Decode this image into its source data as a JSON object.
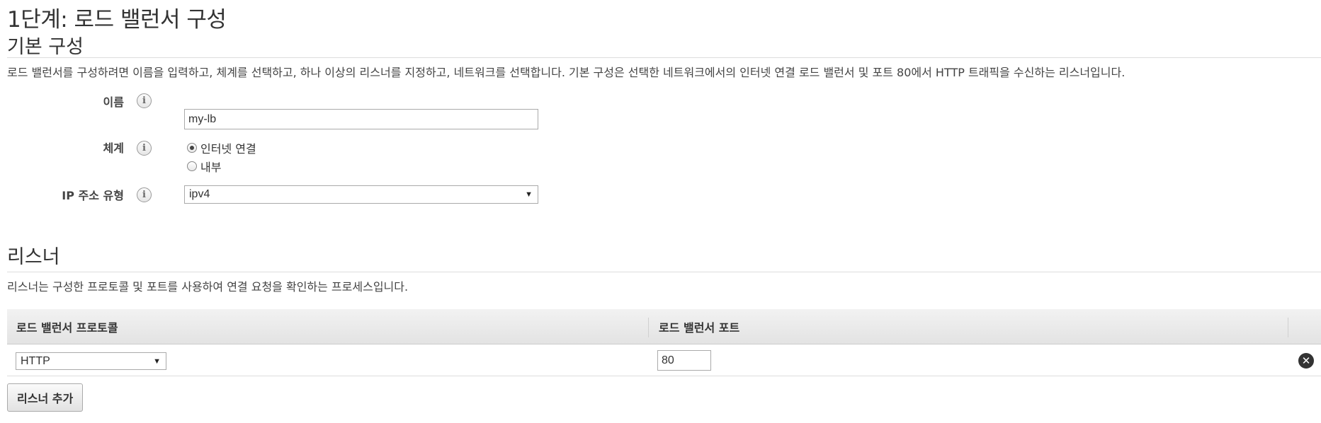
{
  "page": {
    "title": "1단계: 로드 밸런서 구성"
  },
  "basic": {
    "title": "기본 구성",
    "description": "로드 밸런서를 구성하려면 이름을 입력하고, 체계를 선택하고, 하나 이상의 리스너를 지정하고, 네트워크를 선택합니다. 기본 구성은 선택한 네트워크에서의 인터넷 연결 로드 밸런서 및 포트 80에서 HTTP 트래픽을 수신하는 리스너입니다.",
    "name_label": "이름",
    "name_value": "my-lb",
    "scheme_label": "체계",
    "scheme_options": [
      {
        "label": "인터넷 연결",
        "checked": true
      },
      {
        "label": "내부",
        "checked": false
      }
    ],
    "ip_label": "IP 주소 유형",
    "ip_value": "ipv4",
    "info_glyph": "i"
  },
  "listeners": {
    "title": "리스너",
    "description": "리스너는 구성한 프로토콜 및 포트를 사용하여 연결 요청을 확인하는 프로세스입니다.",
    "columns": [
      "로드 밸런서 프로토콜",
      "로드 밸런서 포트"
    ],
    "rows": [
      {
        "protocol": "HTTP",
        "port": "80"
      }
    ],
    "add_button": "리스너 추가"
  },
  "icons": {
    "info": "info-icon",
    "remove": "close-circle-icon",
    "dropdown": "dropdown-arrow-icon"
  }
}
